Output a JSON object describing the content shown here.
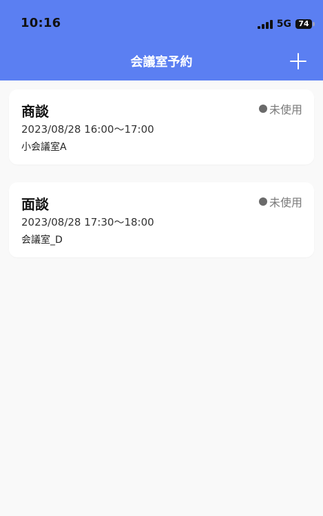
{
  "status_bar": {
    "time": "10:16",
    "network": "5G",
    "battery": "74"
  },
  "header": {
    "title": "会議室予約",
    "add_icon": "plus-icon"
  },
  "reservations": [
    {
      "title": "商談",
      "status": "未使用",
      "datetime": "2023/08/28 16:00〜17:00",
      "room": "小会議室A"
    },
    {
      "title": "面談",
      "status": "未使用",
      "datetime": "2023/08/28 17:30〜18:00",
      "room": "会議室_D"
    }
  ],
  "colors": {
    "header": "#5b7ff2",
    "background": "#f9f9f9",
    "card": "#ffffff",
    "status": "#7a7a7a"
  }
}
